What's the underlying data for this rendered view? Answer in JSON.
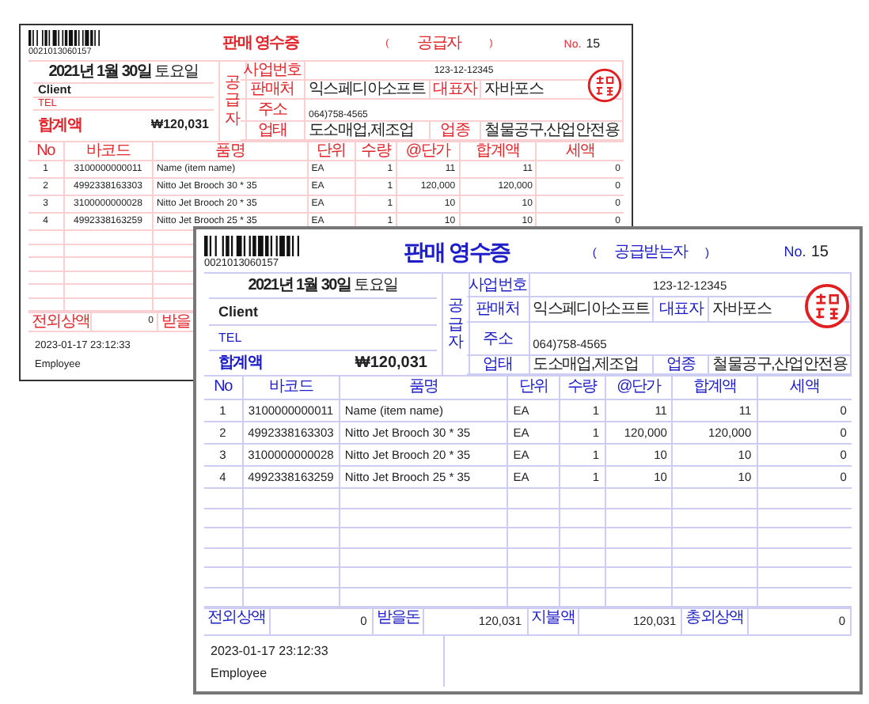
{
  "receipts": [
    {
      "color": "#e3262c",
      "barcode_number": "0021013060157",
      "title": "판매 영수증",
      "party_open": "(",
      "party": "공급자",
      "party_close": ")",
      "no_label": "No.",
      "number": "15",
      "date": "**2021년 1월 30일** 토요일",
      "client": "Client",
      "tel": "TEL",
      "total_label": "합계액",
      "total": "₩120,031",
      "side_label": "공급자",
      "info": {
        "reg_label": "사업번호",
        "reg_number": "123-12-12345",
        "seller_label": "판매처",
        "seller": "익스페디아소프트",
        "rep_label": "대표자",
        "rep": "자바포스",
        "address_label": "주소",
        "address": "064)758-4565",
        "business_label": "업태",
        "business": "도소매업,제조업",
        "category_label": "업종",
        "category": "철물공구,산업안전용"
      },
      "columns": [
        "No",
        "바코드",
        "품명",
        "단위",
        "수량",
        "@단가",
        "합계액",
        "세액"
      ],
      "rows": [
        [
          "1",
          "3100000000011",
          "Name (item name)",
          "EA",
          "1",
          "11",
          "11",
          "0"
        ],
        [
          "2",
          "4992338163303",
          "Nitto Jet Brooch 30 * 35",
          "EA",
          "1",
          "120,000",
          "120,000",
          "0"
        ],
        [
          "3",
          "3100000000028",
          "Nitto Jet Brooch 20 * 35",
          "EA",
          "1",
          "10",
          "10",
          "0"
        ],
        [
          "4",
          "4992338163259",
          "Nitto Jet Brooch 25 * 35",
          "EA",
          "1",
          "10",
          "10",
          "0"
        ]
      ],
      "footer": [
        "전외상액",
        "0",
        "받을"
      ],
      "timestamp": "2023-01-17 23:12:33",
      "employee": "Employee"
    },
    {
      "color": "#1c1cc8",
      "barcode_number": "0021013060157",
      "title": "판매 영수증",
      "party_open": "(",
      "party": "공급받는자",
      "party_close": ")",
      "no_label": "No.",
      "number": "15",
      "date": "**2021년 1월 30일** 토요일",
      "client": "Client",
      "tel": "TEL",
      "total_label": "합계액",
      "total": "₩120,031",
      "side_label": "공급자",
      "info": {
        "reg_label": "사업번호",
        "reg_number": "123-12-12345",
        "seller_label": "판매처",
        "seller": "익스페디아소프트",
        "rep_label": "대표자",
        "rep": "자바포스",
        "address_label": "주소",
        "address": "064)758-4565",
        "business_label": "업태",
        "business": "도소매업,제조업",
        "category_label": "업종",
        "category": "철물공구,산업안전용"
      },
      "columns": [
        "No",
        "바코드",
        "품명",
        "단위",
        "수량",
        "@단가",
        "합계액",
        "세액"
      ],
      "rows": [
        [
          "1",
          "3100000000011",
          "Name (item name)",
          "EA",
          "1",
          "11",
          "11",
          "0"
        ],
        [
          "2",
          "4992338163303",
          "Nitto Jet Brooch 30 * 35",
          "EA",
          "1",
          "120,000",
          "120,000",
          "0"
        ],
        [
          "3",
          "3100000000028",
          "Nitto Jet Brooch 20 * 35",
          "EA",
          "1",
          "10",
          "10",
          "0"
        ],
        [
          "4",
          "4992338163259",
          "Nitto Jet Brooch 25 * 35",
          "EA",
          "1",
          "10",
          "10",
          "0"
        ]
      ],
      "footer": [
        "전외상액",
        "0",
        "받을돈",
        "120,031",
        "지불액",
        "120,031",
        "총외상액",
        "0"
      ],
      "timestamp": "2023-01-17 23:12:33",
      "employee": "Employee"
    }
  ]
}
